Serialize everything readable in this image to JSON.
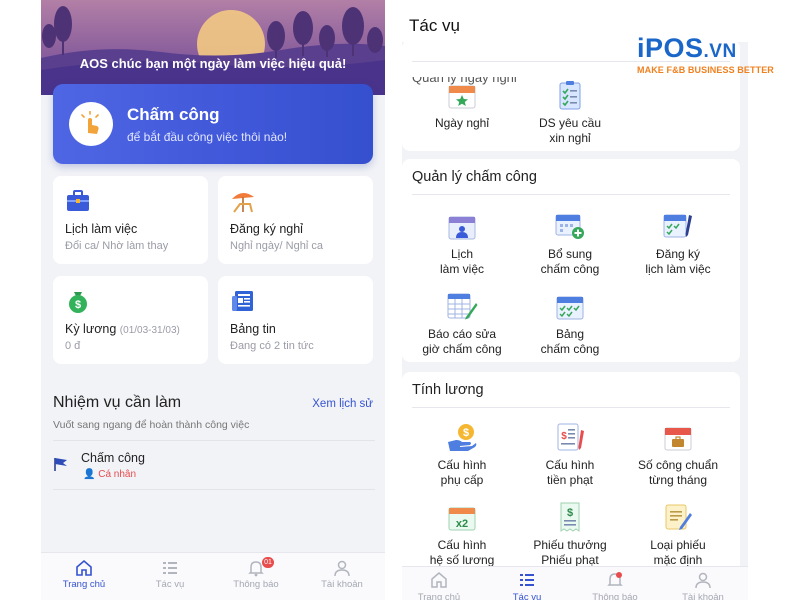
{
  "left_screen": {
    "greeting": "AOS chúc bạn một ngày làm việc hiệu quả!",
    "checkin_card": {
      "title": "Chấm công",
      "subtitle": "để bắt đầu công việc thôi nào!"
    },
    "tiles": [
      {
        "title": "Lịch làm việc",
        "subtitle": "Đổi ca/ Nhờ làm thay",
        "icon": "briefcase-icon"
      },
      {
        "title": "Đăng ký nghỉ",
        "subtitle": "Nghỉ ngày/ Nghỉ ca",
        "icon": "beach-chair-icon"
      },
      {
        "title": "Kỳ lương",
        "title_extra": "(01/03-31/03)",
        "subtitle": "0 đ",
        "icon": "money-bag-icon"
      },
      {
        "title": "Bảng tin",
        "subtitle": "Đang có 2 tin tức",
        "icon": "newspaper-icon"
      }
    ],
    "tasks": {
      "title": "Nhiệm vụ cần làm",
      "history_link": "Xem lịch sử",
      "hint": "Vuốt sang ngang để hoàn thành công việc",
      "items": [
        {
          "name": "Chấm công",
          "owner": "Cá nhân"
        }
      ]
    },
    "tabbar": [
      {
        "label": "Trang chủ",
        "icon": "home-icon",
        "active": true
      },
      {
        "label": "Tác vụ",
        "icon": "list-icon",
        "active": false
      },
      {
        "label": "Thông báo",
        "icon": "bell-icon",
        "active": false,
        "badge": "01"
      },
      {
        "label": "Tài khoản",
        "icon": "user-icon",
        "active": false
      }
    ]
  },
  "right_screen": {
    "title": "Tác vụ",
    "section_leave": {
      "title": "Quản lý ngày nghỉ",
      "items": [
        {
          "label_1": "Ngày nghỉ",
          "label_2": "",
          "icon": "calendar-star-icon"
        },
        {
          "label_1": "DS yêu cầu",
          "label_2": "xin nghỉ",
          "icon": "checklist-icon"
        }
      ]
    },
    "section_attendance": {
      "title": "Quản lý chấm công",
      "items": [
        {
          "label_1": "Lịch",
          "label_2": "làm việc",
          "icon": "calendar-user-icon"
        },
        {
          "label_1": "Bổ sung",
          "label_2": "chấm công",
          "icon": "calendar-add-icon"
        },
        {
          "label_1": "Đăng ký",
          "label_2": "lịch làm việc",
          "icon": "calendar-pen-icon"
        },
        {
          "label_1": "Báo cáo sửa",
          "label_2": "giờ chấm công",
          "icon": "table-edit-icon"
        },
        {
          "label_1": "Bảng",
          "label_2": "chấm công",
          "icon": "calendar-check-icon"
        }
      ]
    },
    "section_salary": {
      "title": "Tính lương",
      "items": [
        {
          "label_1": "Cấu hình",
          "label_2": "phụ cấp",
          "icon": "hand-coin-icon"
        },
        {
          "label_1": "Cấu hình",
          "label_2": "tiền phạt",
          "icon": "invoice-pen-icon"
        },
        {
          "label_1": "Số công chuẩn",
          "label_2": "từng tháng",
          "icon": "calendar-briefcase-icon"
        },
        {
          "label_1": "Cấu hình",
          "label_2": "hệ số lương",
          "icon": "multiplier-icon"
        },
        {
          "label_1": "Phiếu thưởng",
          "label_2": "Phiếu phạt",
          "icon": "receipt-icon"
        },
        {
          "label_1": "Loại phiếu",
          "label_2": "mặc định",
          "icon": "note-pencil-icon"
        }
      ]
    },
    "tabbar": [
      {
        "label": "Trang chủ",
        "icon": "home-icon",
        "active": false
      },
      {
        "label": "Tác vụ",
        "icon": "list-icon",
        "active": true
      },
      {
        "label": "Thông báo",
        "icon": "bell-icon",
        "active": false
      },
      {
        "label": "Tài khoản",
        "icon": "user-icon",
        "active": false
      }
    ]
  },
  "brand": {
    "logo_main": "iPOS",
    "logo_suffix": ".VN",
    "tagline": "MAKE F&B BUSINESS BETTER"
  },
  "colors": {
    "primary": "#3553d1",
    "brand_blue": "#1a67c9",
    "brand_orange": "#f0801e",
    "alert_red": "#e84c4c"
  }
}
